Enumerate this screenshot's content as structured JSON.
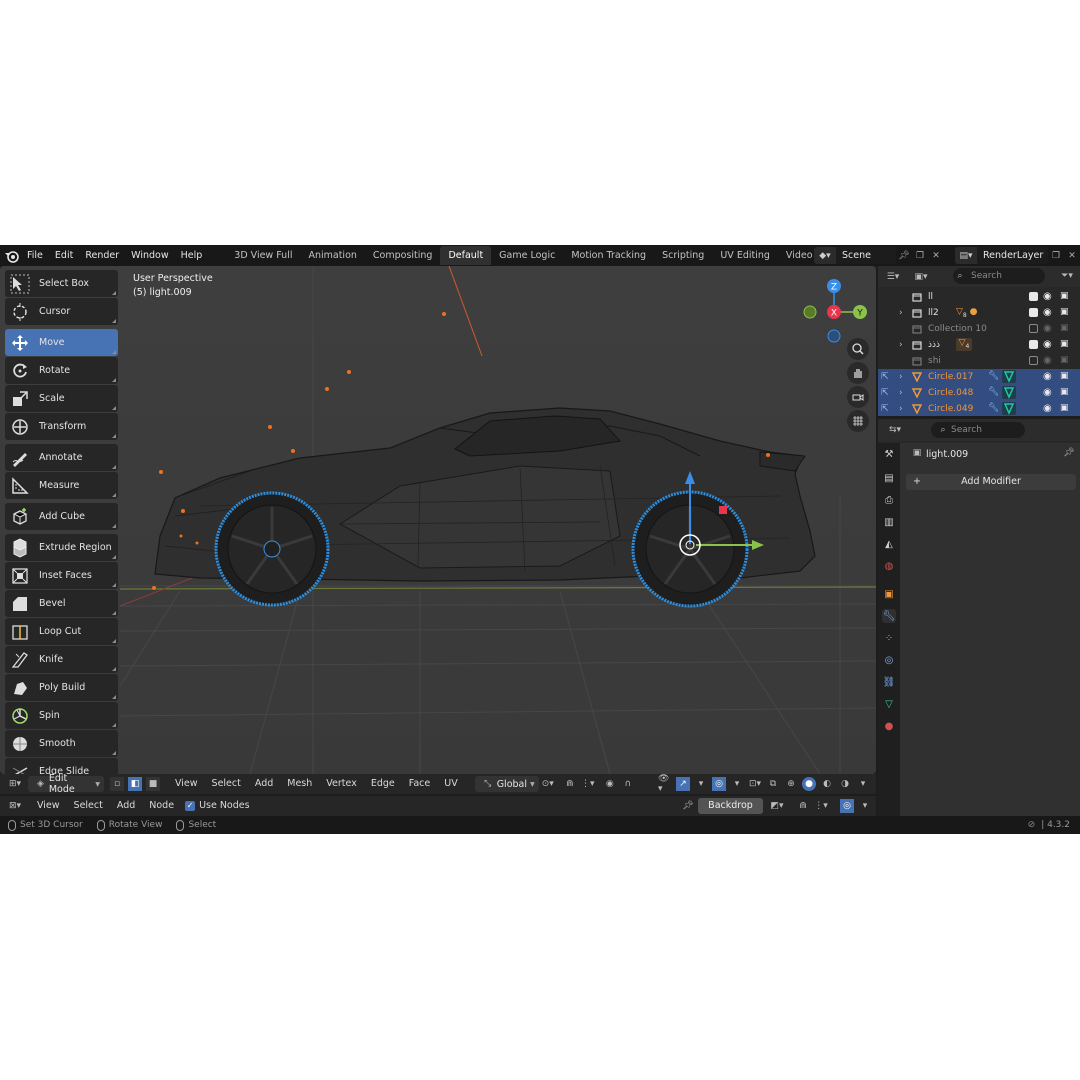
{
  "menu": [
    "File",
    "Edit",
    "Render",
    "Window",
    "Help"
  ],
  "workspace_tabs": [
    {
      "label": "3D View Full",
      "active": false
    },
    {
      "label": "Animation",
      "active": false
    },
    {
      "label": "Compositing",
      "active": false
    },
    {
      "label": "Default",
      "active": true
    },
    {
      "label": "Game Logic",
      "active": false
    },
    {
      "label": "Motion Tracking",
      "active": false
    },
    {
      "label": "Scripting",
      "active": false
    },
    {
      "label": "UV Editing",
      "active": false
    },
    {
      "label": "Video Editing",
      "active": false
    }
  ],
  "tab_add": "+",
  "scene": {
    "name": "Scene"
  },
  "render_layer": {
    "name": "RenderLayer"
  },
  "viewport": {
    "perspective": "User Perspective",
    "object": "(5) light.009",
    "gizmo_axes": {
      "z": "Z",
      "x": "X",
      "y": "Y"
    }
  },
  "tools": [
    {
      "label": "Select Box",
      "icon": "select-box-icon",
      "active": false,
      "group_start": false
    },
    {
      "label": "Cursor",
      "icon": "cursor-icon",
      "active": false,
      "group_start": false
    },
    {
      "label": "Move",
      "icon": "move-icon",
      "active": true,
      "group_start": true
    },
    {
      "label": "Rotate",
      "icon": "rotate-icon",
      "active": false,
      "group_start": false
    },
    {
      "label": "Scale",
      "icon": "scale-icon",
      "active": false,
      "group_start": false
    },
    {
      "label": "Transform",
      "icon": "transform-icon",
      "active": false,
      "group_start": false
    },
    {
      "label": "Annotate",
      "icon": "annotate-icon",
      "active": false,
      "group_start": true
    },
    {
      "label": "Measure",
      "icon": "measure-icon",
      "active": false,
      "group_start": false
    },
    {
      "label": "Add Cube",
      "icon": "add-cube-icon",
      "active": false,
      "group_start": true
    },
    {
      "label": "Extrude Region",
      "icon": "extrude-region-icon",
      "active": false,
      "group_start": true
    },
    {
      "label": "Inset Faces",
      "icon": "inset-faces-icon",
      "active": false,
      "group_start": false
    },
    {
      "label": "Bevel",
      "icon": "bevel-icon",
      "active": false,
      "group_start": false
    },
    {
      "label": "Loop Cut",
      "icon": "loop-cut-icon",
      "active": false,
      "group_start": false
    },
    {
      "label": "Knife",
      "icon": "knife-icon",
      "active": false,
      "group_start": false
    },
    {
      "label": "Poly Build",
      "icon": "poly-build-icon",
      "active": false,
      "group_start": false
    },
    {
      "label": "Spin",
      "icon": "spin-icon",
      "active": false,
      "group_start": false
    },
    {
      "label": "Smooth",
      "icon": "smooth-icon",
      "active": false,
      "group_start": false
    },
    {
      "label": "Edge Slide",
      "icon": "edge-slide-icon",
      "active": false,
      "group_start": false
    }
  ],
  "vp_header": {
    "mode": "Edit Mode",
    "menus": [
      "View",
      "Select",
      "Add",
      "Mesh",
      "Vertex",
      "Edge",
      "Face",
      "UV"
    ],
    "orientation": "Global"
  },
  "node_header": {
    "menus": [
      "View",
      "Select",
      "Add",
      "Node"
    ],
    "use_nodes": "Use Nodes",
    "backdrop": "Backdrop"
  },
  "status": {
    "items": [
      "Set 3D Cursor",
      "Rotate View",
      "Select"
    ],
    "version": "4.3.2"
  },
  "outliner": {
    "search_placeholder": "Search",
    "rows": [
      {
        "name": "ll",
        "selected": false,
        "expandable": false,
        "checked": true,
        "dim": false,
        "name_color": "#e0e0e0"
      },
      {
        "name": "ll2",
        "selected": false,
        "expandable": true,
        "checked": true,
        "dim": false,
        "name_color": "#e0e0e0"
      },
      {
        "name": "Collection 10",
        "selected": false,
        "expandable": false,
        "checked": false,
        "dim": true,
        "name_color": "#8a8a8a"
      },
      {
        "name": "ذذذ",
        "selected": false,
        "expandable": true,
        "checked": true,
        "dim": false,
        "name_color": "#e0e0e0"
      },
      {
        "name": "shi",
        "selected": false,
        "expandable": false,
        "checked": false,
        "dim": true,
        "name_color": "#8a8a8a"
      },
      {
        "name": "Circle.017",
        "selected": true,
        "expandable": true,
        "checked": null,
        "dim": false,
        "name_color": "#f0963c"
      },
      {
        "name": "Circle.048",
        "selected": true,
        "expandable": true,
        "checked": null,
        "dim": false,
        "name_color": "#f0963c"
      },
      {
        "name": "Circle.049",
        "selected": true,
        "expandable": true,
        "checked": null,
        "dim": false,
        "name_color": "#f0963c"
      }
    ],
    "badge_ll2": "8",
    "badge_dhal": "4"
  },
  "properties": {
    "search_placeholder": "Search",
    "object_name": "light.009",
    "add_modifier": "Add Modifier",
    "tabs": [
      "tool-icon",
      "render-icon",
      "output-icon",
      "view-layer-icon",
      "scene-icon",
      "world-icon",
      "object-icon",
      "modifier-icon",
      "particles-icon",
      "physics-icon",
      "constraints-icon",
      "data-icon",
      "material-icon"
    ]
  },
  "colors": {
    "accent": "#4772b3",
    "selected_row": "#334d80",
    "axis_x": "#e8374d",
    "axis_y": "#8bc34a",
    "axis_z": "#3b8ee8",
    "object_orange": "#f0963c",
    "edit_blue": "#3aa0ff"
  }
}
